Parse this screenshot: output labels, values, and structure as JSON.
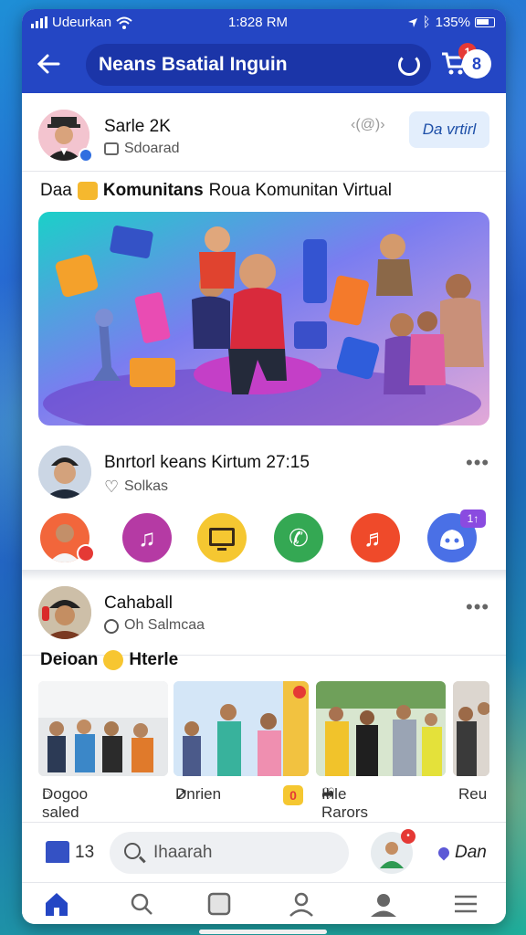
{
  "status_bar": {
    "carrier": "Udeurkan",
    "time": "1:828 RM",
    "battery": "135%"
  },
  "header": {
    "title": "Neans Bsatial Inguin",
    "cart_badge": "1",
    "profile_letter": "8"
  },
  "post_author": {
    "name": "Sarle 2K",
    "sub": "Sdoarad",
    "action_label": "Da vrtirl",
    "lens_label": "‹(@)›"
  },
  "caption": {
    "prefix": "Daa",
    "text": "Komunitans Roua Komunitan Virtual"
  },
  "post2": {
    "name": "Bnrtorl keans Kirtum 27:15",
    "sub": "Solkas",
    "more": "•••"
  },
  "app_icons": [
    {
      "name": "profile",
      "color": "#f2663b"
    },
    {
      "name": "music",
      "color": "#b53aa4"
    },
    {
      "name": "tv",
      "color": "#f5c731"
    },
    {
      "name": "phone",
      "color": "#34a853"
    },
    {
      "name": "audio",
      "color": "#ef4a2a"
    },
    {
      "name": "discord",
      "color": "#4a70e6"
    }
  ],
  "discord_badge": "1↑",
  "post3": {
    "name": "Cahaball",
    "sub": "Oh Salmcaa",
    "more": "•••"
  },
  "section": {
    "title_left": "Deioan",
    "title_right": "Hterle"
  },
  "actions": {
    "comment": "Dogoo saled",
    "share": "Dnrien",
    "badge": "0",
    "react": "Ihle Rarors",
    "reply": "Reu"
  },
  "composer": {
    "count": "13",
    "search_placeholder": "Ihaarah",
    "location": "Dan"
  },
  "colors": {
    "brand": "#2446c4",
    "brand_dark": "#1b35a8",
    "notification": "#e53935"
  }
}
